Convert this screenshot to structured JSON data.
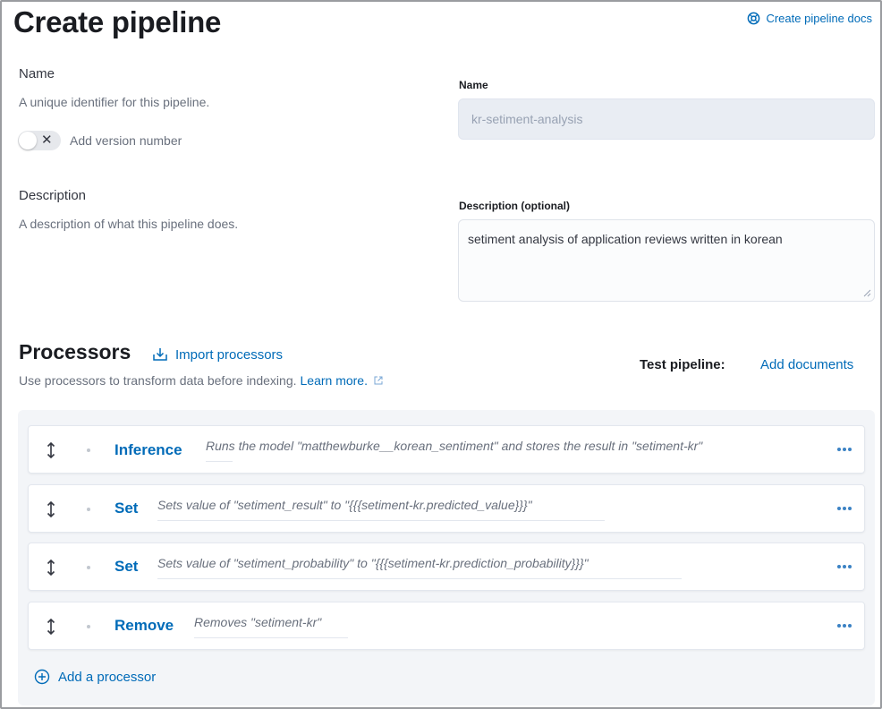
{
  "page": {
    "title": "Create pipeline",
    "docs_link": "Create pipeline docs"
  },
  "name_section": {
    "title": "Name",
    "description": "A unique identifier for this pipeline.",
    "toggle_label": "Add version number",
    "toggle_on": false,
    "field_label": "Name",
    "field_value": "kr-setiment-analysis"
  },
  "description_section": {
    "title": "Description",
    "description": "A description of what this pipeline does.",
    "field_label": "Description (optional)",
    "field_value": "setiment analysis of application reviews written in korean"
  },
  "processors": {
    "title": "Processors",
    "import_label": "Import processors",
    "description": "Use processors to transform data before indexing.",
    "learn_more": "Learn more.",
    "test_label": "Test pipeline:",
    "add_documents": "Add documents",
    "items": [
      {
        "name": "Inference",
        "description": "Runs the model \"matthewburke__korean_sentiment\" and stores the result in \"setiment-kr\""
      },
      {
        "name": "Set",
        "description": "Sets value of \"setiment_result\" to \"{{{setiment-kr.predicted_value}}}\""
      },
      {
        "name": "Set",
        "description": "Sets value of \"setiment_probability\" to \"{{{setiment-kr.prediction_probability}}}\""
      },
      {
        "name": "Remove",
        "description": "Removes \"setiment-kr\""
      }
    ],
    "add_processor": "Add a processor"
  },
  "colors": {
    "link": "#006bb8",
    "title": "#1a1c21",
    "muted": "#69707d",
    "panel": "#f3f5f8"
  }
}
